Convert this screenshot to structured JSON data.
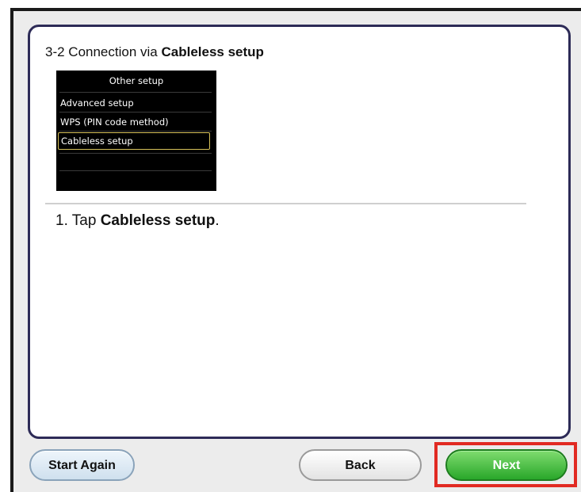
{
  "panel": {
    "title_prefix": "3-2 Connection via ",
    "title_bold": "Cableless setup"
  },
  "printer_screen": {
    "header": "Other setup",
    "items": [
      {
        "label": "Advanced setup",
        "selected": false
      },
      {
        "label": "WPS (PIN code method)",
        "selected": false
      },
      {
        "label": "Cableless setup",
        "selected": true
      }
    ],
    "selection_color": "#d8c25a"
  },
  "instruction": {
    "prefix": "1. Tap ",
    "bold": "Cableless setup",
    "suffix": "."
  },
  "buttons": {
    "start_again": "Start Again",
    "back": "Back",
    "next": "Next"
  },
  "colors": {
    "panel_border": "#2d2b57",
    "next_button": "#29a72a",
    "highlight_box": "#e12a22"
  }
}
